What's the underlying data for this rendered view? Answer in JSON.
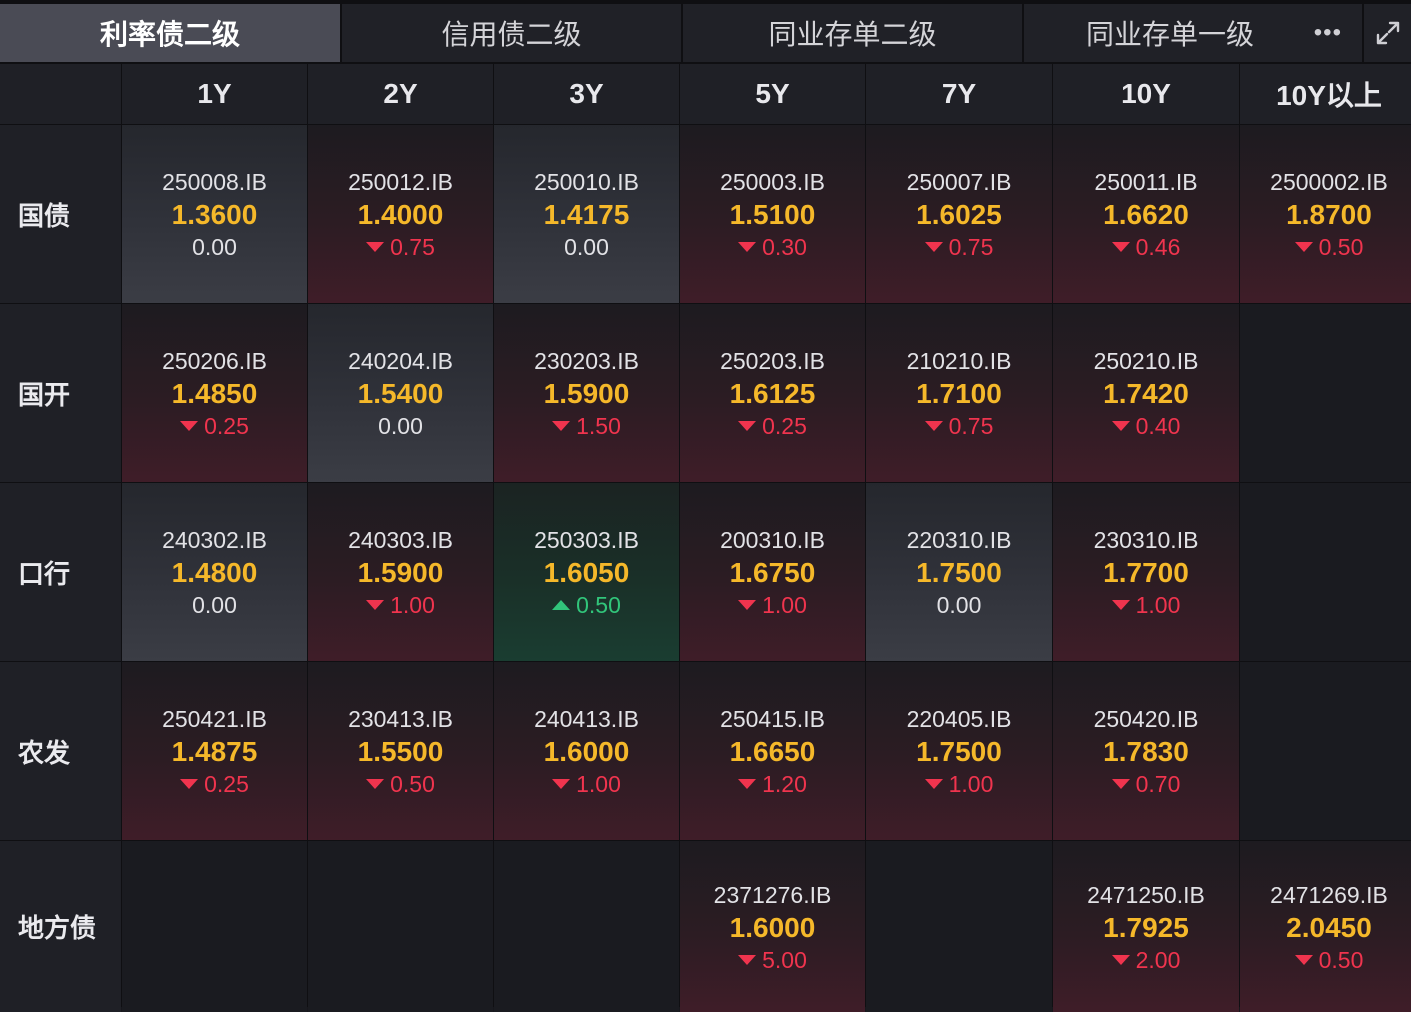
{
  "tabs": [
    {
      "label": "利率债二级",
      "active": true
    },
    {
      "label": "信用债二级",
      "active": false
    },
    {
      "label": "同业存单二级",
      "active": false
    },
    {
      "label": "同业存单一级",
      "active": false
    }
  ],
  "icons": {
    "more": "more-icon",
    "expand": "expand-icon"
  },
  "colors": {
    "yield": "#f5b82a",
    "down": "#f0344e",
    "up": "#31c57a",
    "active_tab": "#4a4b55"
  },
  "columns": [
    "1Y",
    "2Y",
    "3Y",
    "5Y",
    "7Y",
    "10Y",
    "10Y以上"
  ],
  "rows": [
    {
      "label": "国债",
      "cells": [
        {
          "code": "250008.IB",
          "yield": "1.3600",
          "change": "0.00",
          "dir": "flat"
        },
        {
          "code": "250012.IB",
          "yield": "1.4000",
          "change": "0.75",
          "dir": "down"
        },
        {
          "code": "250010.IB",
          "yield": "1.4175",
          "change": "0.00",
          "dir": "flat"
        },
        {
          "code": "250003.IB",
          "yield": "1.5100",
          "change": "0.30",
          "dir": "down"
        },
        {
          "code": "250007.IB",
          "yield": "1.6025",
          "change": "0.75",
          "dir": "down"
        },
        {
          "code": "250011.IB",
          "yield": "1.6620",
          "change": "0.46",
          "dir": "down"
        },
        {
          "code": "2500002.IB",
          "yield": "1.8700",
          "change": "0.50",
          "dir": "down"
        }
      ]
    },
    {
      "label": "国开",
      "cells": [
        {
          "code": "250206.IB",
          "yield": "1.4850",
          "change": "0.25",
          "dir": "down"
        },
        {
          "code": "240204.IB",
          "yield": "1.5400",
          "change": "0.00",
          "dir": "flat"
        },
        {
          "code": "230203.IB",
          "yield": "1.5900",
          "change": "1.50",
          "dir": "down"
        },
        {
          "code": "250203.IB",
          "yield": "1.6125",
          "change": "0.25",
          "dir": "down"
        },
        {
          "code": "210210.IB",
          "yield": "1.7100",
          "change": "0.75",
          "dir": "down"
        },
        {
          "code": "250210.IB",
          "yield": "1.7420",
          "change": "0.40",
          "dir": "down"
        },
        null
      ]
    },
    {
      "label": "口行",
      "cells": [
        {
          "code": "240302.IB",
          "yield": "1.4800",
          "change": "0.00",
          "dir": "flat"
        },
        {
          "code": "240303.IB",
          "yield": "1.5900",
          "change": "1.00",
          "dir": "down"
        },
        {
          "code": "250303.IB",
          "yield": "1.6050",
          "change": "0.50",
          "dir": "up"
        },
        {
          "code": "200310.IB",
          "yield": "1.6750",
          "change": "1.00",
          "dir": "down"
        },
        {
          "code": "220310.IB",
          "yield": "1.7500",
          "change": "0.00",
          "dir": "flat"
        },
        {
          "code": "230310.IB",
          "yield": "1.7700",
          "change": "1.00",
          "dir": "down"
        },
        null
      ]
    },
    {
      "label": "农发",
      "cells": [
        {
          "code": "250421.IB",
          "yield": "1.4875",
          "change": "0.25",
          "dir": "down"
        },
        {
          "code": "230413.IB",
          "yield": "1.5500",
          "change": "0.50",
          "dir": "down"
        },
        {
          "code": "240413.IB",
          "yield": "1.6000",
          "change": "1.00",
          "dir": "down"
        },
        {
          "code": "250415.IB",
          "yield": "1.6650",
          "change": "1.20",
          "dir": "down"
        },
        {
          "code": "220405.IB",
          "yield": "1.7500",
          "change": "1.00",
          "dir": "down"
        },
        {
          "code": "250420.IB",
          "yield": "1.7830",
          "change": "0.70",
          "dir": "down"
        },
        null
      ]
    },
    {
      "label": "地方债",
      "cells": [
        null,
        null,
        null,
        {
          "code": "2371276.IB",
          "yield": "1.6000",
          "change": "5.00",
          "dir": "down"
        },
        null,
        {
          "code": "2471250.IB",
          "yield": "1.7925",
          "change": "2.00",
          "dir": "down"
        },
        {
          "code": "2471269.IB",
          "yield": "2.0450",
          "change": "0.50",
          "dir": "down"
        }
      ]
    }
  ]
}
